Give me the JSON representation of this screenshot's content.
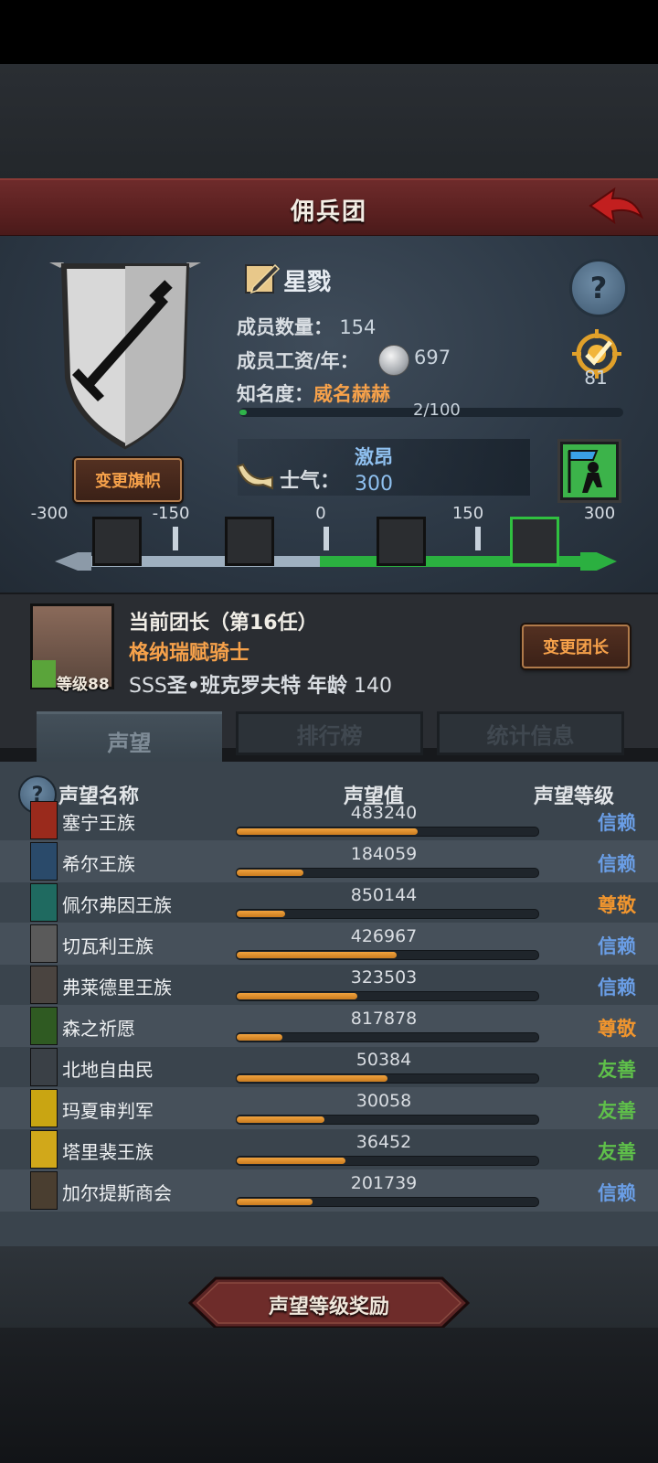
{
  "header": {
    "title": "佣兵团",
    "back_icon": "back-arrow-icon"
  },
  "guild": {
    "name": "星戮",
    "members_label": "成员数量：",
    "members_value": "154",
    "salary_label": "成员工资/年：",
    "salary_value": "697",
    "fame_label": "知名度：",
    "fame_value": "威名赫赫",
    "fame_progress": "2/100",
    "fame_fraction": 0.02,
    "badge_value": "81",
    "change_flag_label": "变更旗帜"
  },
  "morale": {
    "label": "士气",
    "state": "激昂",
    "value": "300",
    "scale_ticks": [
      "-300",
      "-150",
      "0",
      "150",
      "300"
    ],
    "scale_range": [
      -300,
      300
    ],
    "current": 300
  },
  "leader": {
    "title": "当前团长（第16任）",
    "class": "格纳瑞赋骑士",
    "rank_prefix": "SSS",
    "name": "圣•班克罗夫特",
    "age_label": "年龄",
    "age_value": "140",
    "level_label": "等级88",
    "change_label": "变更团长"
  },
  "tabs": [
    {
      "label": "声望",
      "active": true
    },
    {
      "label": "排行榜",
      "active": false
    },
    {
      "label": "统计信息",
      "active": false
    }
  ],
  "reputation": {
    "headers": {
      "name": "声望名称",
      "value": "声望值",
      "level": "声望等级"
    },
    "rows": [
      {
        "name": "塞宁王族",
        "value": "483240",
        "fill": 0.6,
        "level": "信赖",
        "type": "trust",
        "color": "#9a2a1c"
      },
      {
        "name": "希尔王族",
        "value": "184059",
        "fill": 0.22,
        "level": "信赖",
        "type": "trust",
        "color": "#2a4a6a"
      },
      {
        "name": "佩尔弗因王族",
        "value": "850144",
        "fill": 0.16,
        "level": "尊敬",
        "type": "respect",
        "color": "#1f6a60"
      },
      {
        "name": "切瓦利王族",
        "value": "426967",
        "fill": 0.53,
        "level": "信赖",
        "type": "trust",
        "color": "#5a5a5a"
      },
      {
        "name": "弗莱德里王族",
        "value": "323503",
        "fill": 0.4,
        "level": "信赖",
        "type": "trust",
        "color": "#4a4440"
      },
      {
        "name": "森之祈愿",
        "value": "817878",
        "fill": 0.15,
        "level": "尊敬",
        "type": "respect",
        "color": "#2f5a22"
      },
      {
        "name": "北地自由民",
        "value": "50384",
        "fill": 0.5,
        "level": "友善",
        "type": "friend",
        "color": "#3a4046"
      },
      {
        "name": "玛夏审判军",
        "value": "30058",
        "fill": 0.29,
        "level": "友善",
        "type": "friend",
        "color": "#c9a512"
      },
      {
        "name": "塔里裴王族",
        "value": "36452",
        "fill": 0.36,
        "level": "友善",
        "type": "friend",
        "color": "#d1a81a"
      },
      {
        "name": "加尔提斯商会",
        "value": "201739",
        "fill": 0.25,
        "level": "信赖",
        "type": "trust",
        "color": "#4a3e30"
      }
    ]
  },
  "footer": {
    "reward_button": "声望等级奖励"
  }
}
